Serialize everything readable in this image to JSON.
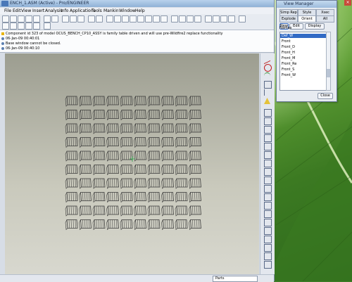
{
  "app": {
    "title": "ENCH_1.ASM (Active) - Pro/ENGINEER",
    "menu": [
      "File",
      "Edit",
      "View",
      "Insert",
      "Analysis",
      "Info",
      "Applications",
      "Tools",
      "Mankin",
      "Window",
      "Help"
    ],
    "messages": [
      {
        "text": "Component id 323 of model OCUS_BENCH_CP10_ASSY is family table driven and will use pre-Wildfire2 replace functionality"
      },
      {
        "text": "06-Jan-09 00:40:01"
      },
      {
        "text": "Base window cannot be closed."
      },
      {
        "text": "06-Jan-09 00:40:10"
      }
    ],
    "status": {
      "filter_value": "Parts"
    }
  },
  "view_manager": {
    "title": "View Manager",
    "tabs_row1": [
      "Simp Rep",
      "Style",
      "Xsec"
    ],
    "tabs_row2": [
      "Explode",
      "Orient",
      "All"
    ],
    "buttons": {
      "new": "New",
      "edit": "Edit",
      "display": "Display"
    },
    "list_header": "Names",
    "items": [
      "Def_W",
      "Front",
      "Front_D",
      "Front_H",
      "Front_M",
      "Front_Re",
      "Front_S",
      "Front_W"
    ],
    "selected_index": 0,
    "close_label": "Close"
  },
  "colors": {
    "selection": "#316ac5",
    "bench": "#3a3a3a"
  }
}
